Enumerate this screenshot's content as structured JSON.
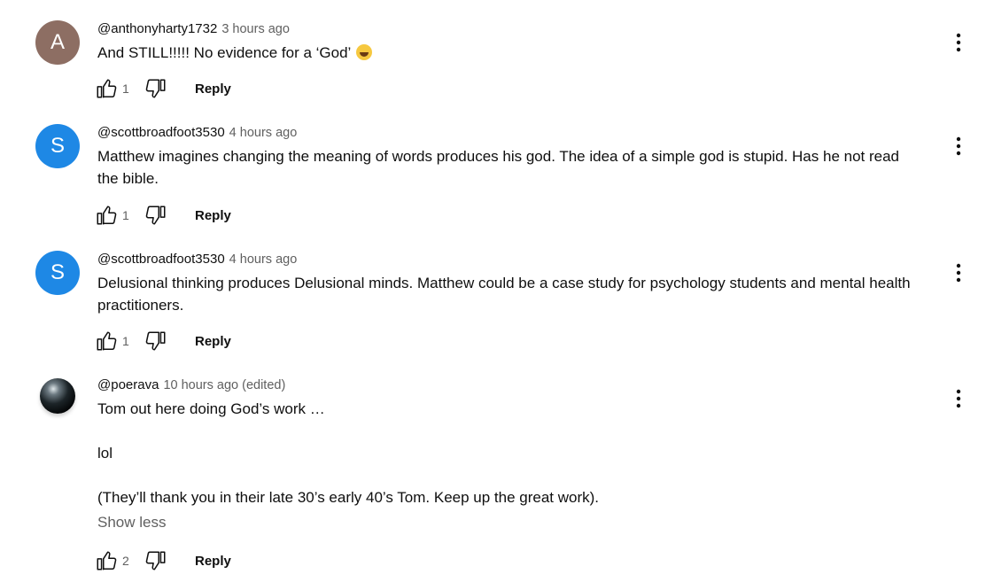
{
  "comments": [
    {
      "avatar_letter": "A",
      "avatar_color": "#8d6e63",
      "author": "@anthonyharty1732",
      "time": "3 hours ago",
      "text": "And STILL!!!!! No evidence for a ‘God’",
      "emoji": "face-with-tears-of-joy",
      "like_count": "1",
      "reply_label": "Reply"
    },
    {
      "avatar_letter": "S",
      "avatar_color": "#1e88e5",
      "author": "@scottbroadfoot3530",
      "time": "4 hours ago",
      "text": "Matthew imagines changing the meaning of words produces his god. The idea of a simple god is stupid. Has he not read the bible.",
      "like_count": "1",
      "reply_label": "Reply"
    },
    {
      "avatar_letter": "S",
      "avatar_color": "#1e88e5",
      "author": "@scottbroadfoot3530",
      "time": "4 hours ago",
      "text": "Delusional thinking produces Delusional minds. Matthew could be a case study for psychology students and mental health practitioners.",
      "like_count": "1",
      "reply_label": "Reply"
    },
    {
      "avatar_image": "black-pearl",
      "author": "@poerava",
      "time": "10 hours ago (edited)",
      "text": "Tom out here doing God’s work …\n\nlol\n\n(They’ll thank you in their late 30’s early 40’s Tom. Keep up the great work).",
      "show_less_label": "Show less",
      "like_count": "2",
      "reply_label": "Reply"
    }
  ]
}
